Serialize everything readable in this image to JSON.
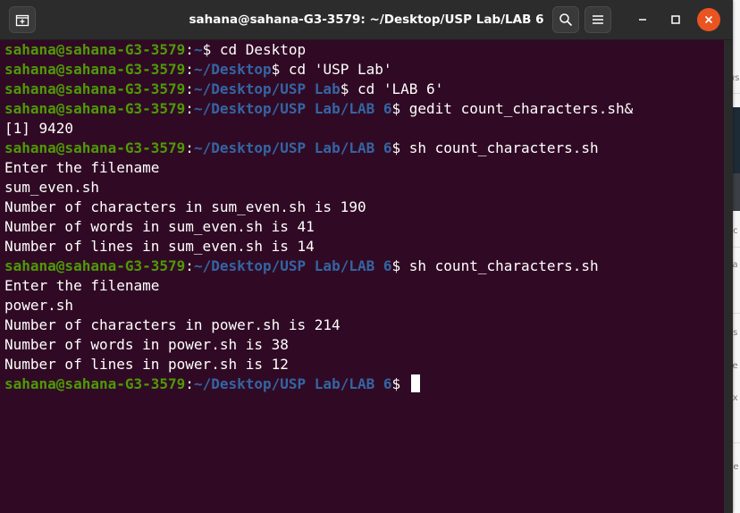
{
  "window": {
    "title": "sahana@sahana-G3-3579: ~/Desktop/USP Lab/LAB 6"
  },
  "icons": {
    "new_tab": "new-tab-icon",
    "search": "search-icon",
    "menu": "hamburger-menu-icon",
    "minimize": "minimize-icon",
    "maximize": "maximize-icon",
    "close": "close-icon"
  },
  "colors": {
    "terminal_bg": "#300a24",
    "prompt_user": "#4e9a06",
    "prompt_path": "#3465a4",
    "text": "#ffffff",
    "close_button": "#e95420"
  },
  "terminal": {
    "prompt_user": "sahana@sahana-G3-3579",
    "lines": [
      {
        "type": "prompt",
        "path": "~",
        "command": "cd Desktop"
      },
      {
        "type": "prompt",
        "path": "~/Desktop",
        "command": "cd 'USP Lab'"
      },
      {
        "type": "prompt",
        "path": "~/Desktop/USP Lab",
        "command": "cd 'LAB 6'"
      },
      {
        "type": "prompt",
        "path": "~/Desktop/USP Lab/LAB 6",
        "command": "gedit count_characters.sh&"
      },
      {
        "type": "output",
        "text": "[1] 9420"
      },
      {
        "type": "prompt",
        "path": "~/Desktop/USP Lab/LAB 6",
        "command": "sh count_characters.sh"
      },
      {
        "type": "output",
        "text": "Enter the filename"
      },
      {
        "type": "output",
        "text": "sum_even.sh"
      },
      {
        "type": "output",
        "text": "Number of characters in sum_even.sh is 190"
      },
      {
        "type": "output",
        "text": "Number of words in sum_even.sh is 41"
      },
      {
        "type": "output",
        "text": "Number of lines in sum_even.sh is 14"
      },
      {
        "type": "prompt",
        "path": "~/Desktop/USP Lab/LAB 6",
        "command": "sh count_characters.sh"
      },
      {
        "type": "output",
        "text": "Enter the filename"
      },
      {
        "type": "output",
        "text": "power.sh"
      },
      {
        "type": "output",
        "text": "Number of characters in power.sh is 214"
      },
      {
        "type": "output",
        "text": "Number of words in power.sh is 38"
      },
      {
        "type": "output",
        "text": "Number of lines in power.sh is 12"
      },
      {
        "type": "prompt",
        "path": "~/Desktop/USP Lab/LAB 6",
        "command": "",
        "cursor": true
      }
    ]
  },
  "background_app": {
    "fragments": [
      "ws",
      "ec",
      "ca",
      "es",
      "ce",
      "ox",
      "ne"
    ]
  }
}
